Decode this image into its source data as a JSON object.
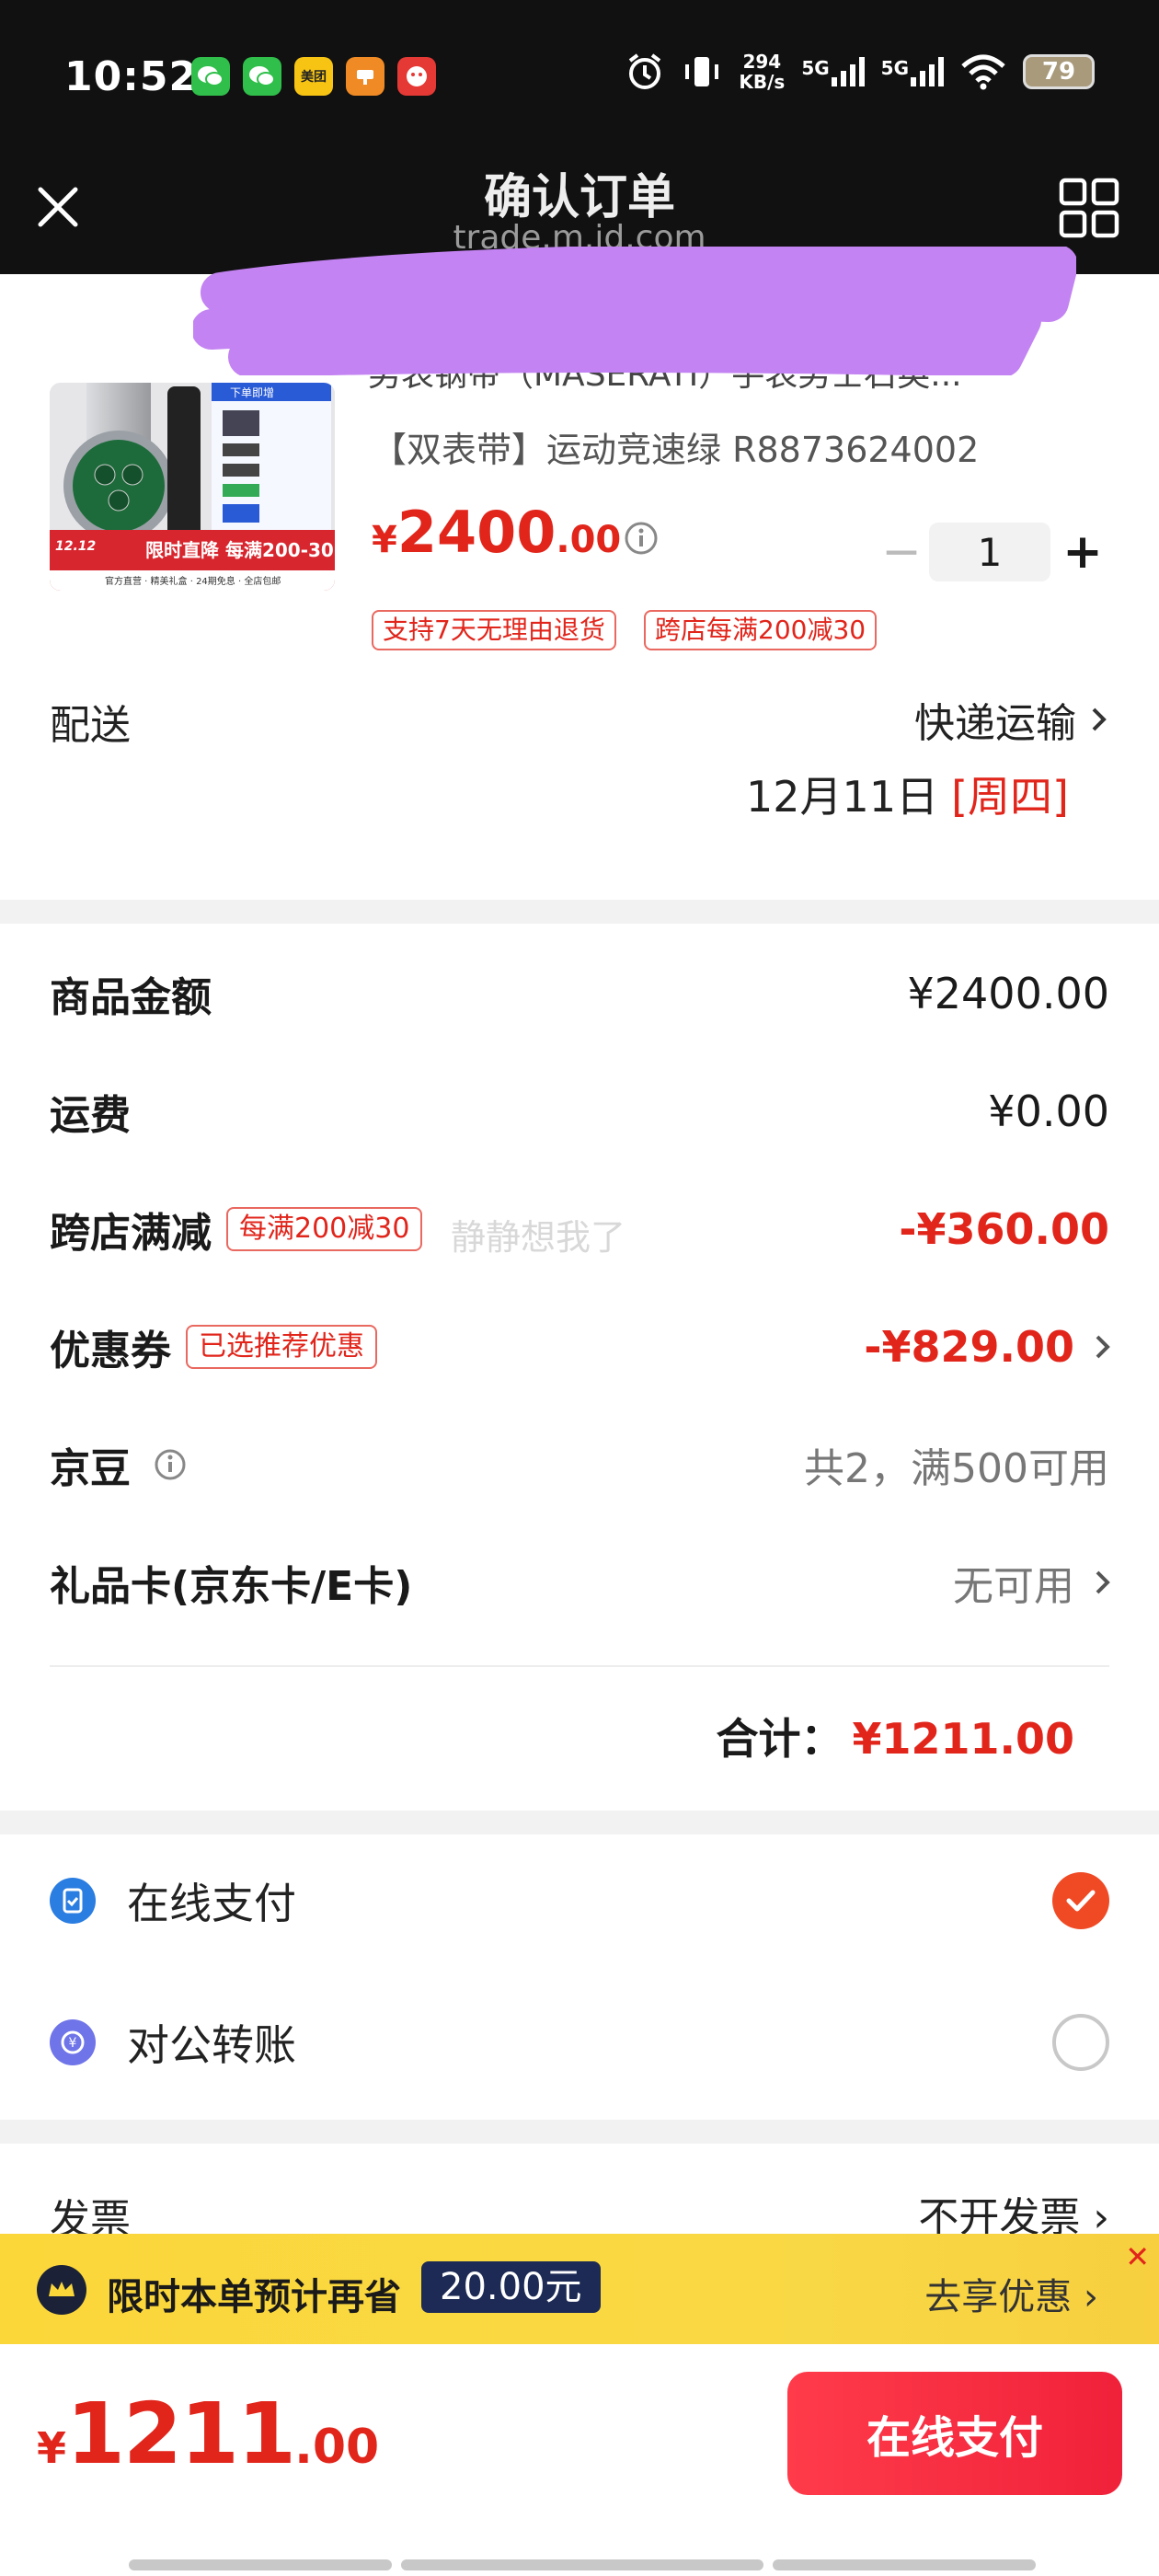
{
  "status_bar": {
    "time": "10:52",
    "app_badges": [
      "美团"
    ],
    "net_speed_value": "294",
    "net_speed_unit": "KB/s",
    "signal_1": "5G",
    "signal_2": "5G",
    "battery": "79"
  },
  "header": {
    "title": "确认订单",
    "subtitle": "trade.m.jd.com"
  },
  "product": {
    "name": "男表钢带（MASERATI）手表男士石英...",
    "spec": "【双表带】运动竞速绿 R8873624002",
    "price_currency": "¥",
    "price_integer": "2400",
    "price_decimal": ".00",
    "quantity": "1",
    "qty_minus": "−",
    "qty_plus": "+",
    "tags": [
      "支持7天无理由退货",
      "跨店每满200减30"
    ],
    "thumb_banner_text": "限时直降 每满200-30",
    "thumb_banner_logo": "12.12",
    "thumb_caption": "官方直营 · 精美礼盒 · 24期免息 · 全店包邮",
    "thumb_box_header": "下单即增"
  },
  "delivery": {
    "label": "配送",
    "method": "快递运输",
    "date": "12月11日",
    "weekday": "[周四]"
  },
  "summary": {
    "goods_label": "商品金额",
    "goods_value": "¥2400.00",
    "shipping_label": "运费",
    "shipping_value": "¥0.00",
    "cross_label": "跨店满减",
    "cross_tag": "每满200减30",
    "cross_value": "-¥360.00",
    "coupon_label": "优惠券",
    "coupon_tag": "已选推荐优惠",
    "coupon_value": "-¥829.00",
    "beans_label": "京豆",
    "beans_value": "共2，满500可用",
    "giftcard_label": "礼品卡(京东卡/E卡)",
    "giftcard_value": "无可用",
    "total_label": "合计：",
    "total_value": "¥1211.00",
    "watermark": "静静想我了"
  },
  "payment": {
    "online_label": "在线支付",
    "transfer_label": "对公转账",
    "selected": "online"
  },
  "invoice": {
    "label": "发票",
    "value": "不开发票"
  },
  "promo": {
    "text": "限时本单预计再省",
    "amount": "20.00元",
    "link": "去享优惠"
  },
  "bottom": {
    "currency": "¥",
    "integer": "1211",
    "decimal": ".00",
    "pay_button": "在线支付"
  },
  "colors": {
    "accent_red": "#e1251b",
    "promo_yellow": "#fbd73a",
    "pay_button": "#f0213a",
    "header_bg": "#111111"
  }
}
